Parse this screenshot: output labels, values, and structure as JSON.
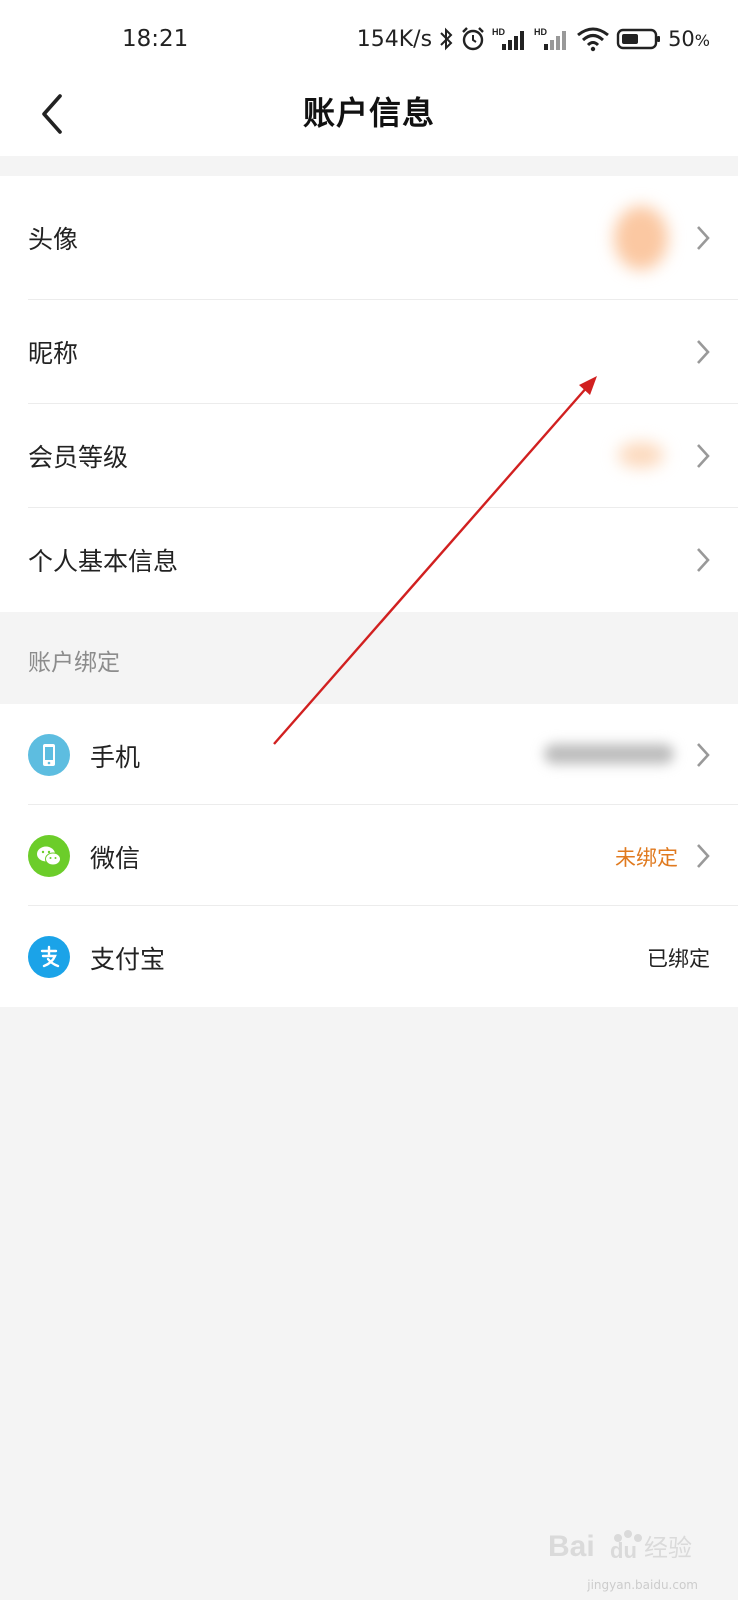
{
  "status_bar": {
    "time": "18:21",
    "net_speed": "154K/s",
    "battery": "50",
    "battery_unit": "%"
  },
  "header": {
    "title": "账户信息"
  },
  "profile": {
    "items": [
      {
        "label": "头像"
      },
      {
        "label": "昵称"
      },
      {
        "label": "会员等级"
      },
      {
        "label": "个人基本信息"
      }
    ]
  },
  "binding": {
    "section_title": "账户绑定",
    "items": [
      {
        "label": "手机",
        "icon": "phone-icon",
        "status": ""
      },
      {
        "label": "微信",
        "icon": "wechat-icon",
        "status": "未绑定"
      },
      {
        "label": "支付宝",
        "icon": "alipay-icon",
        "status": "已绑定"
      }
    ]
  },
  "watermark": {
    "text": "jingyan.baidu.com"
  },
  "colors": {
    "accent_unbound": "#e07a1f",
    "phone_icon_bg": "#5dbde0",
    "wechat_icon_bg": "#6ccd2a",
    "alipay_icon_bg": "#1ba3e8",
    "annotation_arrow": "#d12020"
  }
}
